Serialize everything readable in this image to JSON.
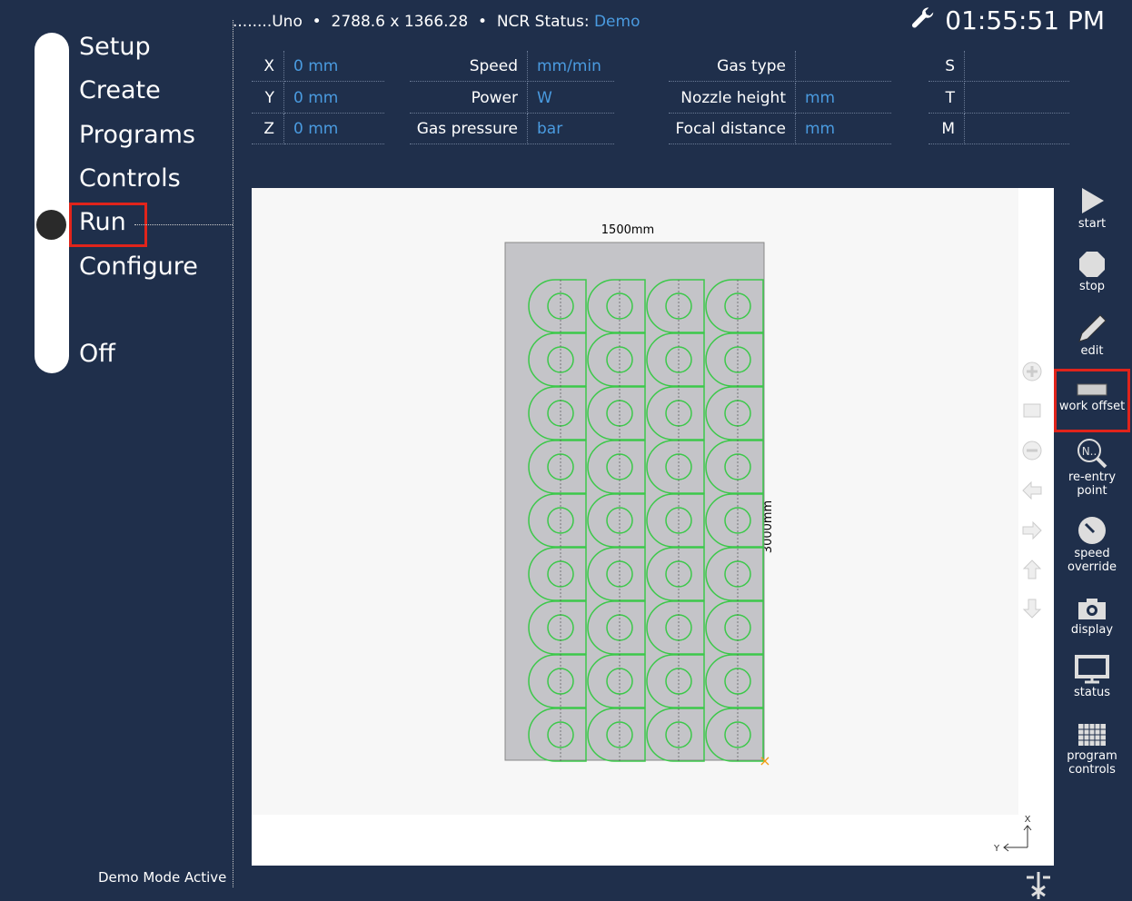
{
  "nav": {
    "items": [
      "Setup",
      "Create",
      "Programs",
      "Controls",
      "Run",
      "Configure",
      "Off"
    ],
    "active": "Run"
  },
  "header": {
    "machine": "Uno",
    "dim_x": "2788.6",
    "sep_x": "x",
    "dim_y": "1366.28",
    "ncr_label": "NCR Status:",
    "ncr_value": "Demo",
    "time": "01:55:51 PM"
  },
  "readouts": {
    "axes": [
      {
        "label": "X",
        "value": "0 mm"
      },
      {
        "label": "Y",
        "value": "0 mm"
      },
      {
        "label": "Z",
        "value": "0 mm"
      }
    ],
    "params1": [
      {
        "label": "Speed",
        "value": "mm/min"
      },
      {
        "label": "Power",
        "value": "W"
      },
      {
        "label": "Gas pressure",
        "value": "bar"
      }
    ],
    "params2": [
      {
        "label": "Gas type",
        "value": ""
      },
      {
        "label": "Nozzle height",
        "value": "mm"
      },
      {
        "label": "Focal distance",
        "value": "mm"
      }
    ],
    "codes": [
      {
        "label": "S",
        "value": ""
      },
      {
        "label": "T",
        "value": ""
      },
      {
        "label": "M",
        "value": ""
      }
    ]
  },
  "sheet": {
    "width_label": "1500mm",
    "height_label": "3000mm",
    "part_columns": 4,
    "part_rows": 9,
    "part_color": "#3cc84a",
    "sheet_color": "#c4c4c8",
    "origin_color": "#f39c12"
  },
  "toolbar": {
    "start": "start",
    "stop": "stop",
    "edit": "edit",
    "work_offset": "work offset",
    "reentry": "re-entry point",
    "speed_override": "speed override",
    "display": "display",
    "status": "status",
    "program_controls": "program controls"
  },
  "axis_indicator": {
    "x": "X",
    "y": "Y"
  },
  "footer": {
    "status": "Demo Mode Active"
  },
  "colors": {
    "background": "#1f2f4b",
    "accent": "#4a9be0",
    "highlight": "#e0241b"
  }
}
